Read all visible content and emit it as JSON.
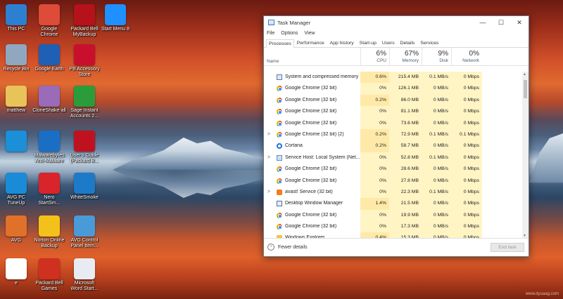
{
  "desktop_icons": [
    {
      "label": "This PC",
      "icon": "computer-icon",
      "color": "#2d7fd0"
    },
    {
      "label": "Google\nChrome",
      "icon": "chrome-icon",
      "color": "#dd4b39"
    },
    {
      "label": "Packard Bell\nMyBackup",
      "icon": "backup-icon",
      "color": "#b5121b"
    },
    {
      "label": "Start Menu 8",
      "icon": "windows-icon",
      "color": "#1e90ff"
    },
    {
      "label": "Recycle Bin",
      "icon": "recycle-bin-icon",
      "color": "#8fa8c0"
    },
    {
      "label": "Google Earth",
      "icon": "globe-icon",
      "color": "#1f5fb5"
    },
    {
      "label": "PB Accessory\nStore",
      "icon": "store-icon",
      "color": "#c8102e"
    },
    {
      "label": "matthew",
      "icon": "user-folder-icon",
      "color": "#e8c35a"
    },
    {
      "label": "CloneShake-all",
      "icon": "clone-icon",
      "color": "#9a6bb8"
    },
    {
      "label": "Sage Instant\nAccounts 2...",
      "icon": "sage-icon",
      "color": "#2a9d3a"
    },
    {
      "label": "",
      "icon": "pse-icon",
      "color": "#1b8fd8"
    },
    {
      "label": "Malwarebytes\nAnti-Malware",
      "icon": "malwarebytes-icon",
      "color": "#1a6fc4"
    },
    {
      "label": "User's Guide\n(Packard B...",
      "icon": "help-icon",
      "color": "#c0121e"
    },
    {
      "label": "AVG PC\nTuneUp",
      "icon": "tuneup-icon",
      "color": "#1a8bd6"
    },
    {
      "label": "Nero\nStartSm...",
      "icon": "nero-icon",
      "color": "#d8242a"
    },
    {
      "label": "WhiteSmoke",
      "icon": "whitesmoke-icon",
      "color": "#1d7ac8"
    },
    {
      "label": "AVG",
      "icon": "avg-icon",
      "color": "#e0712a"
    },
    {
      "label": "Norton Online\nBackup",
      "icon": "norton-icon",
      "color": "#f3c21a"
    },
    {
      "label": "AVG Control\nPanel Item...",
      "icon": "control-panel-icon",
      "color": "#4a9ad8"
    },
    {
      "label": "e",
      "icon": "ebay-icon",
      "color": "#ffffff"
    },
    {
      "label": "Packard Bell\nGames",
      "icon": "games-icon",
      "color": "#d03020"
    },
    {
      "label": "Microsoft\nWord Start...",
      "icon": "word-icon",
      "color": "#e8ecf2"
    }
  ],
  "window": {
    "title": "Task Manager",
    "menu": [
      "File",
      "Options",
      "View"
    ],
    "tabs": [
      "Processes",
      "Performance",
      "App history",
      "Start-up",
      "Users",
      "Details",
      "Services"
    ],
    "active_tab": "Processes"
  },
  "columns": {
    "name": "Name",
    "cpu": {
      "pct": "6%",
      "label": "CPU"
    },
    "memory": {
      "pct": "67%",
      "label": "Memory"
    },
    "disk": {
      "pct": "9%",
      "label": "Disk"
    },
    "network": {
      "pct": "0%",
      "label": "Network"
    }
  },
  "processes": [
    {
      "expand": "",
      "icon": "sys",
      "name": "System and compressed memory",
      "cpu": "0.6%",
      "mem": "215.4 MB",
      "disk": "0.1 MB/s",
      "net": "0 Mbps"
    },
    {
      "expand": "",
      "icon": "chrome",
      "name": "Google Chrome (32 bit)",
      "cpu": "0%",
      "mem": "126.1 MB",
      "disk": "0 MB/s",
      "net": "0 Mbps"
    },
    {
      "expand": "",
      "icon": "chrome",
      "name": "Google Chrome (32 bit)",
      "cpu": "0.2%",
      "mem": "86.0 MB",
      "disk": "0 MB/s",
      "net": "0 Mbps"
    },
    {
      "expand": "",
      "icon": "chrome",
      "name": "Google Chrome (32 bit)",
      "cpu": "0%",
      "mem": "81.1 MB",
      "disk": "0 MB/s",
      "net": "0 Mbps"
    },
    {
      "expand": "",
      "icon": "chrome",
      "name": "Google Chrome (32 bit)",
      "cpu": "0%",
      "mem": "73.6 MB",
      "disk": "0 MB/s",
      "net": "0 Mbps"
    },
    {
      "expand": ">",
      "icon": "chrome",
      "name": "Google Chrome (32 bit) (2)",
      "cpu": "0.2%",
      "mem": "72.9 MB",
      "disk": "0.1 MB/s",
      "net": "0.1 Mbps"
    },
    {
      "expand": "",
      "icon": "cortana",
      "name": "Cortana",
      "cpu": "0.2%",
      "mem": "58.7 MB",
      "disk": "0 MB/s",
      "net": "0 Mbps"
    },
    {
      "expand": ">",
      "icon": "svc",
      "name": "Service Host: Local System (Net...",
      "cpu": "0%",
      "mem": "52.8 MB",
      "disk": "0.1 MB/s",
      "net": "0 Mbps"
    },
    {
      "expand": "",
      "icon": "chrome",
      "name": "Google Chrome (32 bit)",
      "cpu": "0%",
      "mem": "28.6 MB",
      "disk": "0 MB/s",
      "net": "0 Mbps"
    },
    {
      "expand": "",
      "icon": "chrome",
      "name": "Google Chrome (32 bit)",
      "cpu": "0%",
      "mem": "27.8 MB",
      "disk": "0 MB/s",
      "net": "0 Mbps"
    },
    {
      "expand": ">",
      "icon": "avast",
      "name": "avast! Service (32 bit)",
      "cpu": "0%",
      "mem": "22.3 MB",
      "disk": "0.1 MB/s",
      "net": "0 Mbps"
    },
    {
      "expand": "",
      "icon": "dwm",
      "name": "Desktop Window Manager",
      "cpu": "1.4%",
      "mem": "21.5 MB",
      "disk": "0 MB/s",
      "net": "0 Mbps"
    },
    {
      "expand": "",
      "icon": "chrome",
      "name": "Google Chrome (32 bit)",
      "cpu": "0%",
      "mem": "19.9 MB",
      "disk": "0 MB/s",
      "net": "0 Mbps"
    },
    {
      "expand": "",
      "icon": "chrome",
      "name": "Google Chrome (32 bit)",
      "cpu": "0%",
      "mem": "17.3 MB",
      "disk": "0 MB/s",
      "net": "0 Mbps"
    },
    {
      "expand": "",
      "icon": "explorer",
      "name": "Windows Explorer",
      "cpu": "0.4%",
      "mem": "15.3 MB",
      "disk": "0 MB/s",
      "net": "0 Mbps"
    }
  ],
  "footer": {
    "fewer_details": "Fewer details",
    "end_task": "End task"
  },
  "watermark": "www.dyuaag.com"
}
